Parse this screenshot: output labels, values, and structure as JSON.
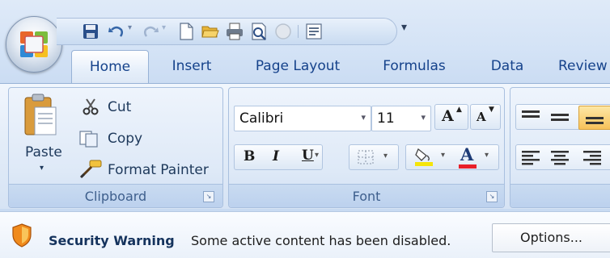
{
  "office_button": {
    "icon": "office-logo-icon"
  },
  "quick_access": {
    "icons": [
      "save-icon",
      "undo-icon",
      "redo-icon",
      "new-document-icon",
      "open-folder-icon",
      "print-icon",
      "print-preview-icon",
      "disabled-circle-icon",
      "properties-icon"
    ],
    "customize": "▾"
  },
  "tabs": [
    {
      "label": "Home",
      "active": true
    },
    {
      "label": "Insert"
    },
    {
      "label": "Page Layout"
    },
    {
      "label": "Formulas"
    },
    {
      "label": "Data"
    },
    {
      "label": "Review"
    }
  ],
  "clipboard": {
    "paste_label": "Paste",
    "cut_label": "Cut",
    "copy_label": "Copy",
    "format_painter_label": "Format Painter",
    "group_label": "Clipboard"
  },
  "font": {
    "font_name": "Calibri",
    "font_size": "11",
    "bold": "B",
    "italic": "I",
    "underline": "U",
    "font_color_letter": "A",
    "group_label": "Font",
    "grow_letter": "A",
    "shrink_letter": "A"
  },
  "colors": {
    "highlight_yellow": "#f5e50a",
    "font_color_red": "#e8202a",
    "tab_text": "#15428b",
    "group_label": "#3e5f8d"
  },
  "security_bar": {
    "title": "Security Warning",
    "message": "Some active content has been disabled.",
    "options_label": "Options..."
  }
}
